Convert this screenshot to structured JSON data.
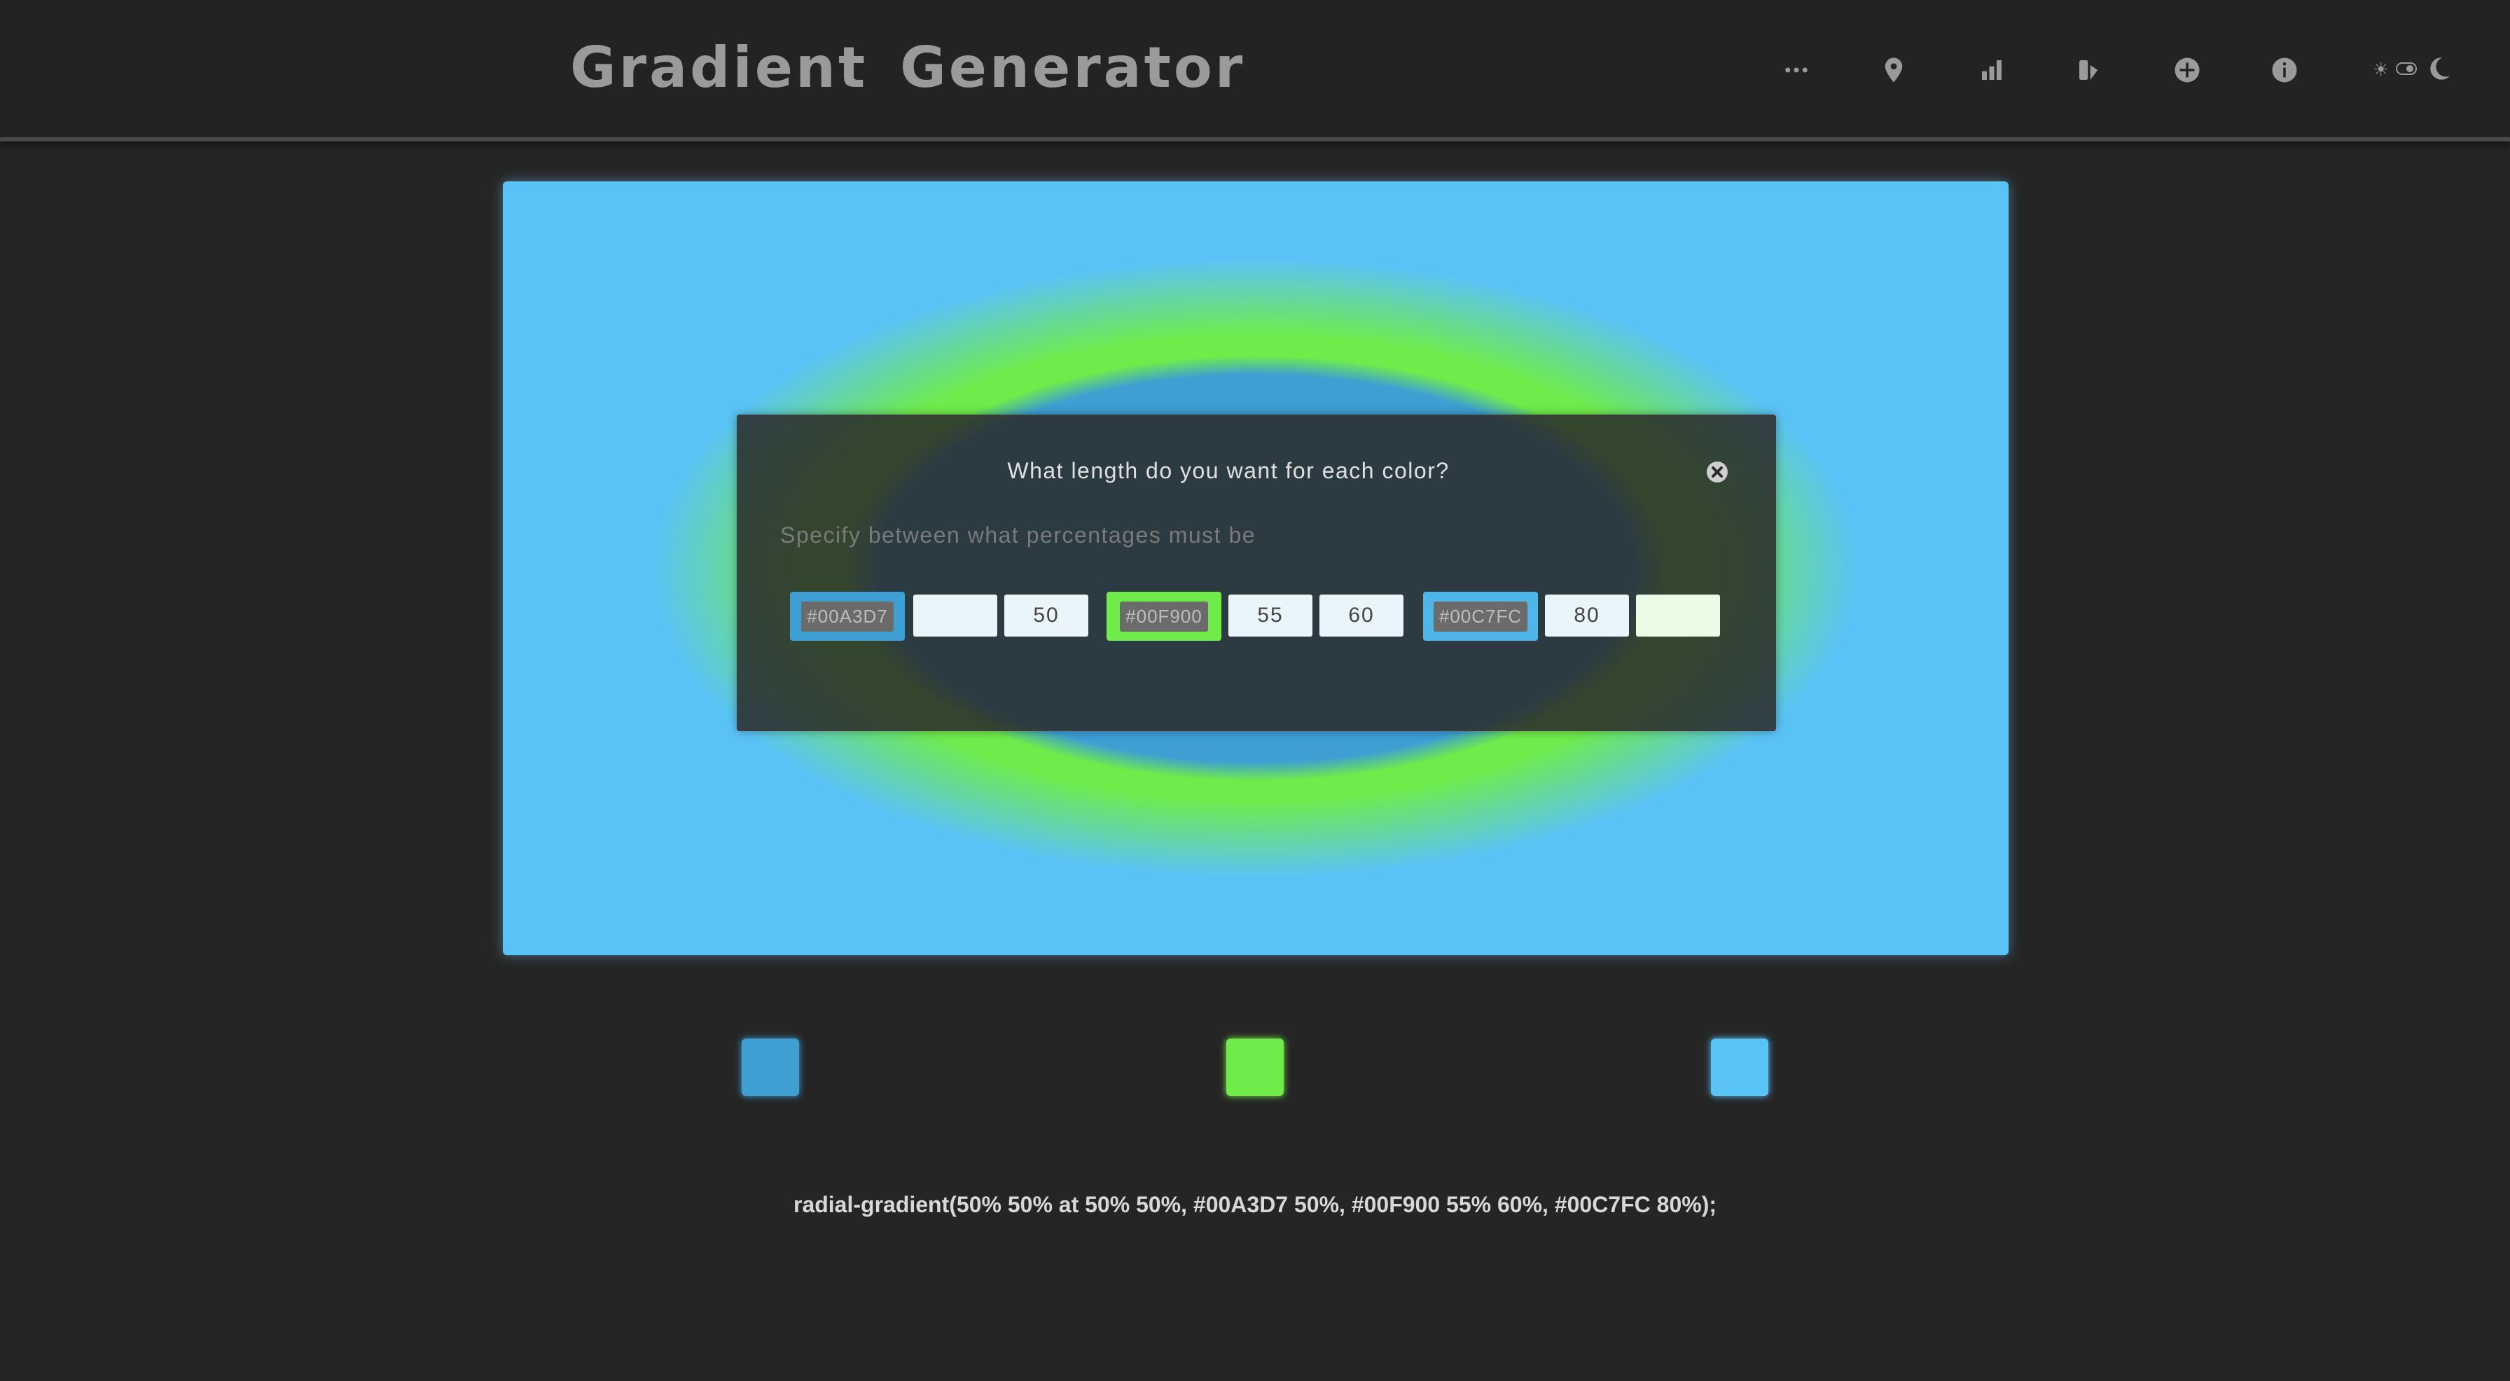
{
  "app": {
    "title": "Gradient Generator"
  },
  "header": {
    "icons": [
      "more-icon",
      "location-pin-icon",
      "bar-chart-icon",
      "palette-icon",
      "add-circle-icon",
      "info-icon"
    ],
    "theme_toggle": {
      "sun": "☀",
      "moon": "moon-icon"
    }
  },
  "gradient": {
    "type": "radial",
    "colors": [
      "#00A3D7",
      "#00F900",
      "#00C7FC"
    ],
    "preview_colors": {
      "outer": "#5AC3F6",
      "ring": "#70EC4A",
      "inner": "#3E9FD3"
    }
  },
  "modal": {
    "title": "What length do you want for each color?",
    "subtitle": "Specify between what percentages must be",
    "stops": [
      {
        "color": "#00A3D7",
        "chip_color": "#3E9FD3",
        "start": "",
        "end": "50"
      },
      {
        "color": "#00F900",
        "chip_color": "#70EC4A",
        "start": "55",
        "end": "60"
      },
      {
        "color": "#00C7FC",
        "chip_color": "#4FB6EA",
        "start": "80",
        "end": ""
      }
    ]
  },
  "swatches": [
    {
      "color": "#3E9FD3"
    },
    {
      "color": "#70EC4A"
    },
    {
      "color": "#5AC3F6"
    }
  ],
  "output": {
    "css": "radial-gradient(50% 50% at 50% 50%, #00A3D7 50%, #00F900 55% 60%, #00C7FC 80%);"
  }
}
